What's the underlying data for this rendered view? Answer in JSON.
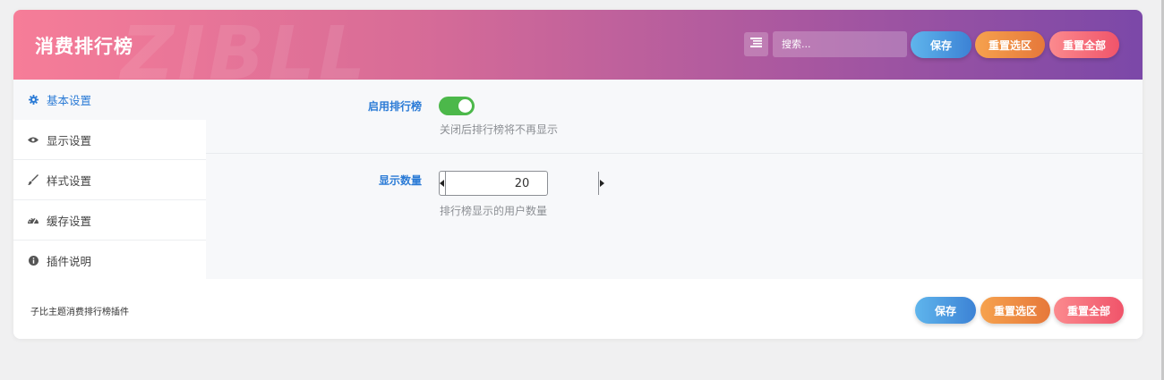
{
  "header": {
    "title": "消费排行榜",
    "watermark": "ZIBLL",
    "search_placeholder": "搜索...",
    "save_label": "保存",
    "reset_section_label": "重置选区",
    "reset_all_label": "重置全部"
  },
  "sidebar": {
    "items": [
      {
        "label": "基本设置",
        "icon": "gear-icon",
        "active": true
      },
      {
        "label": "显示设置",
        "icon": "eye-icon",
        "active": false
      },
      {
        "label": "样式设置",
        "icon": "brush-icon",
        "active": false
      },
      {
        "label": "缓存设置",
        "icon": "dashboard-icon",
        "active": false
      },
      {
        "label": "插件说明",
        "icon": "info-circle-icon",
        "active": false
      }
    ]
  },
  "main": {
    "fields": [
      {
        "title": "启用排行榜",
        "type": "toggle",
        "checked": true,
        "description": "关闭后排行榜将不再显示"
      },
      {
        "title": "显示数量",
        "type": "number",
        "value": "20",
        "description": "排行榜显示的用户数量"
      }
    ]
  },
  "footer": {
    "text": "子比主题消费排行榜插件",
    "save_label": "保存",
    "reset_section_label": "重置选区",
    "reset_all_label": "重置全部"
  },
  "colors": {
    "accent": "#2b7bd6",
    "toggle_on": "#4cb84a",
    "save_button": "#4a9ae0",
    "reset_section_button": "#ee8c44",
    "reset_all_button": "#f56e7c"
  }
}
